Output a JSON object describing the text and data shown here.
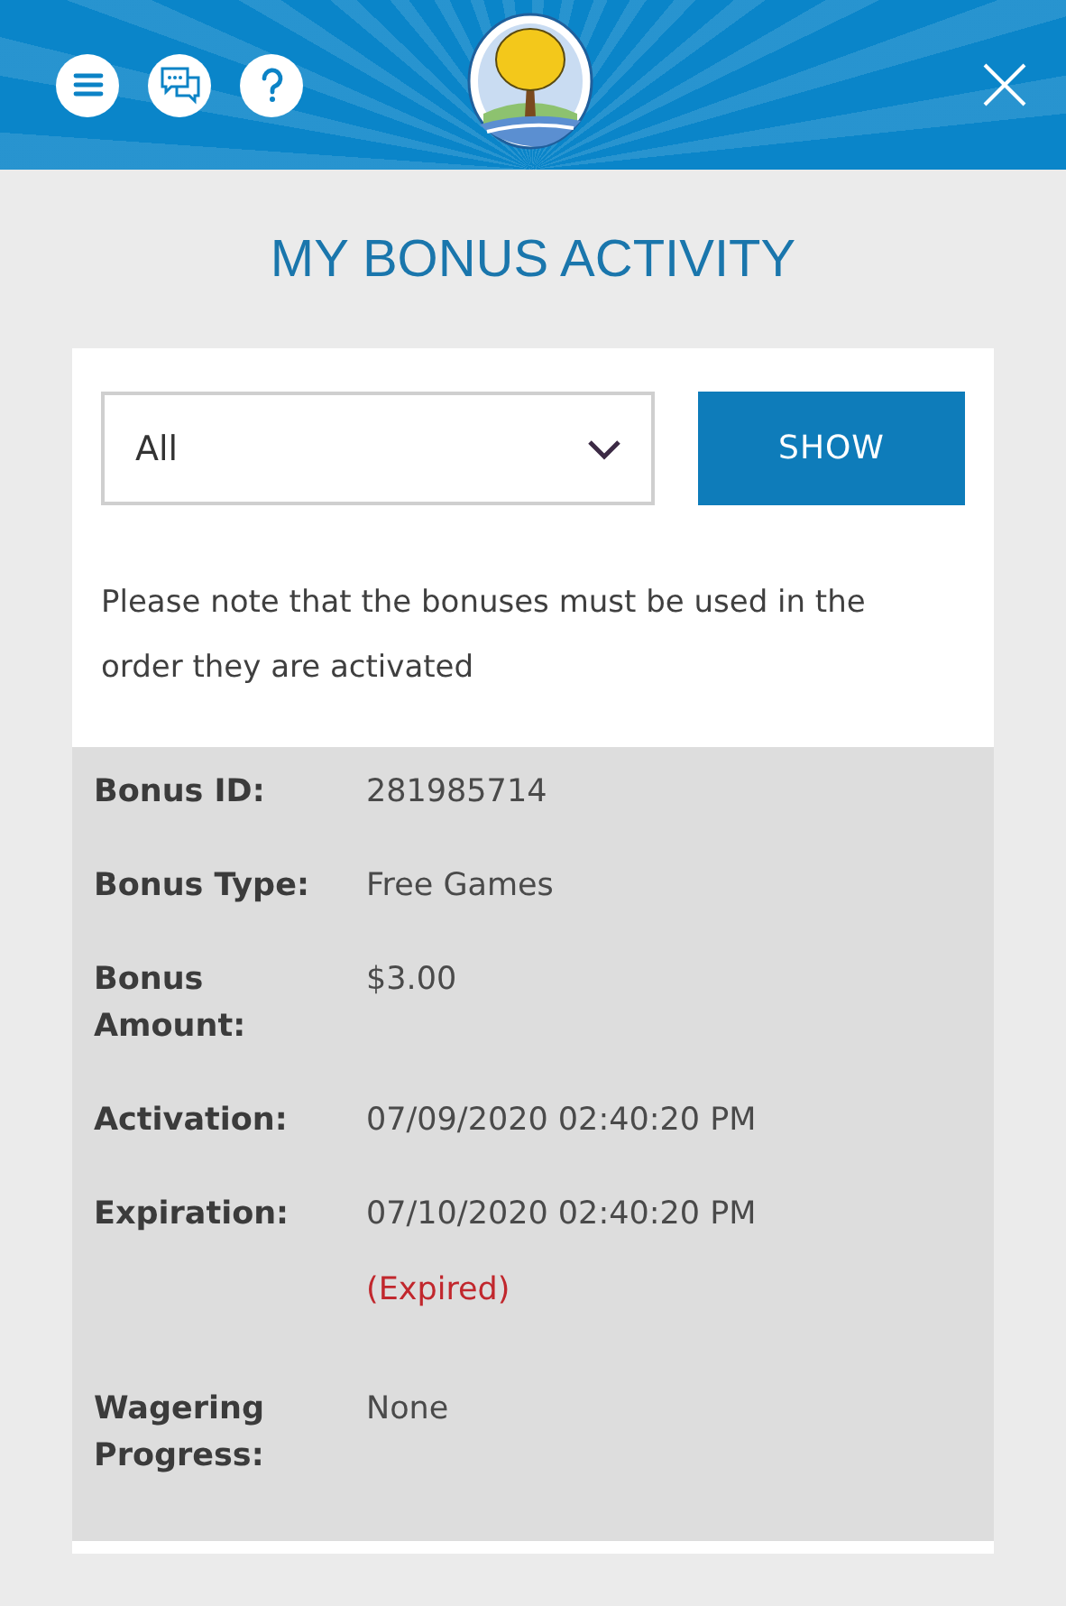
{
  "title": "MY BONUS ACTIVITY",
  "filter": {
    "value": "All",
    "button": "SHOW"
  },
  "note": "Please note that the bonuses must be used in the order they are activated",
  "details": [
    {
      "label": "Bonus ID:",
      "value": "281985714"
    },
    {
      "label": "Bonus Type:",
      "value": "Free Games"
    },
    {
      "label": "Bonus Amount:",
      "value": "$3.00"
    },
    {
      "label": "Activation:",
      "value": "07/09/2020 02:40:20 PM"
    },
    {
      "label": "Expiration:",
      "value": "07/10/2020 02:40:20 PM",
      "status": "(Expired)"
    },
    {
      "label": "Wagering Progress:",
      "value": "None"
    }
  ]
}
